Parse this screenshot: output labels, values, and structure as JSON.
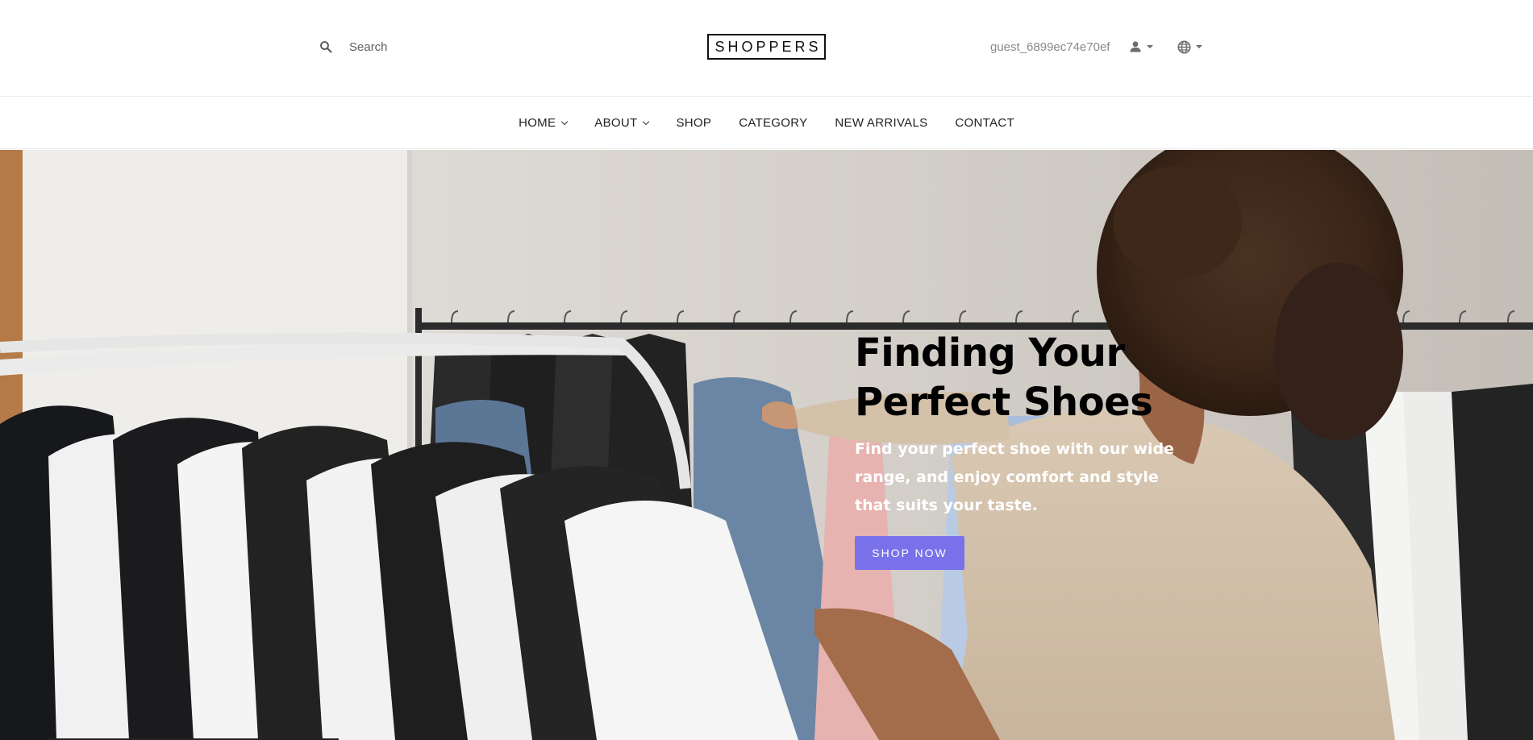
{
  "header": {
    "search_placeholder": "Search",
    "logo_text": "SHOPPERS",
    "username": "guest_6899ec74e70ef",
    "icons": {
      "search": "search-icon",
      "user": "user-icon",
      "globe": "globe-icon"
    }
  },
  "nav": {
    "items": [
      {
        "label": "HOME",
        "has_dropdown": true
      },
      {
        "label": "ABOUT",
        "has_dropdown": true
      },
      {
        "label": "SHOP",
        "has_dropdown": false
      },
      {
        "label": "CATEGORY",
        "has_dropdown": false
      },
      {
        "label": "NEW ARRIVALS",
        "has_dropdown": false
      },
      {
        "label": "CONTACT",
        "has_dropdown": false
      }
    ]
  },
  "hero": {
    "title_line1": "Finding Your",
    "title_line2": "Perfect Shoes",
    "subtitle": "Find your perfect shoe with our wide range, and enjoy comfort and style that suits your taste.",
    "button_label": "SHOP NOW"
  },
  "colors": {
    "accent": "#7971ea",
    "text_dark": "#111111",
    "muted": "#8a8a8a"
  }
}
